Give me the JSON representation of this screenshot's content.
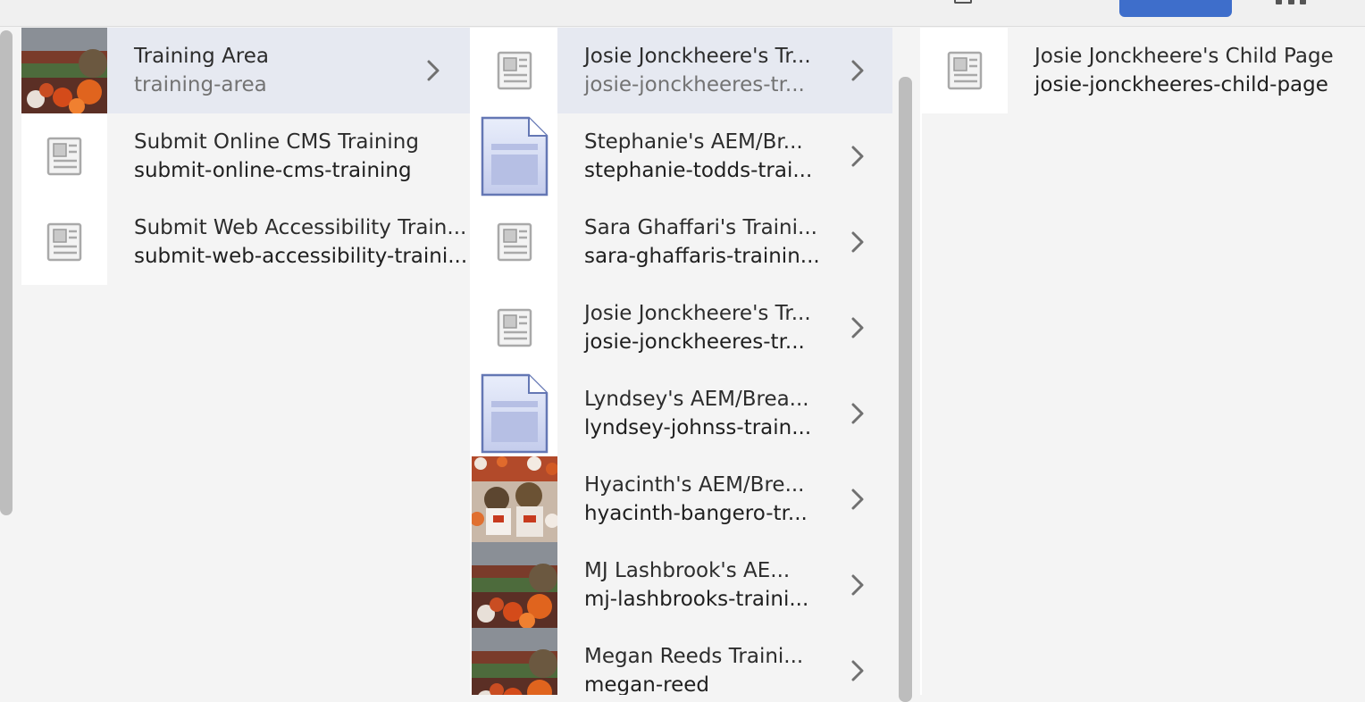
{
  "colors": {
    "accent": "#3e6ecb",
    "selected_row": "#e6e9f1",
    "column_bg": "#f4f4f4",
    "chevron": "#707070"
  },
  "column1": {
    "items": [
      {
        "title": "Training Area",
        "name": "training-area",
        "thumbnail": "photo-thumbnail",
        "selected": true,
        "has_children": true
      },
      {
        "title": "Submit Online CMS Training",
        "name": "submit-online-cms-training",
        "thumbnail": "page-template-icon",
        "selected": false,
        "has_children": false
      },
      {
        "title": "Submit Web Accessibility Train...",
        "name": "submit-web-accessibility-traini...",
        "thumbnail": "page-template-icon",
        "selected": false,
        "has_children": false
      }
    ]
  },
  "column2": {
    "items": [
      {
        "title": "Josie Jonckheere's Tr...",
        "name": "josie-jonckheeres-tr...",
        "thumbnail": "page-template-icon",
        "selected": true,
        "has_children": true
      },
      {
        "title": "Stephanie's AEM/Br...",
        "name": "stephanie-todds-trai...",
        "thumbnail": "document-icon",
        "selected": false,
        "has_children": true
      },
      {
        "title": "Sara Ghaffari's Traini...",
        "name": "sara-ghaffaris-trainin...",
        "thumbnail": "page-template-icon",
        "selected": false,
        "has_children": true
      },
      {
        "title": "Josie Jonckheere's Tr...",
        "name": "josie-jonckheeres-tr...",
        "thumbnail": "page-template-icon",
        "selected": false,
        "has_children": true
      },
      {
        "title": "Lyndsey's AEM/Brea...",
        "name": "lyndsey-johnss-train...",
        "thumbnail": "document-icon",
        "selected": false,
        "has_children": true
      },
      {
        "title": "Hyacinth's AEM/Bre...",
        "name": "hyacinth-bangero-tr...",
        "thumbnail": "photo-thumbnail",
        "selected": false,
        "has_children": true
      },
      {
        "title": "MJ Lashbrook's AE...",
        "name": "mj-lashbrooks-traini...",
        "thumbnail": "photo-thumbnail",
        "selected": false,
        "has_children": true
      },
      {
        "title": "Megan Reeds Traini...",
        "name": "megan-reed",
        "thumbnail": "photo-thumbnail",
        "selected": false,
        "has_children": true
      }
    ]
  },
  "column3": {
    "items": [
      {
        "title": "Josie Jonckheere's Child Page",
        "name": "josie-jonckheeres-child-page",
        "thumbnail": "page-template-icon",
        "selected": false,
        "has_children": false
      }
    ]
  }
}
